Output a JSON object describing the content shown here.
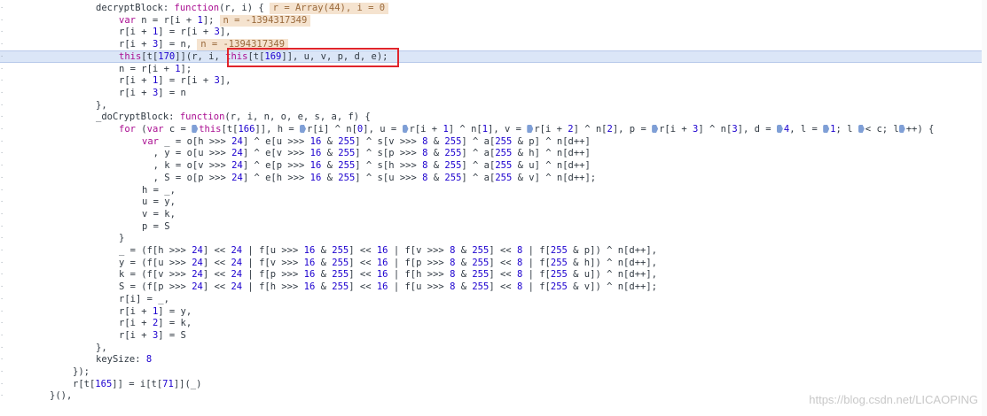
{
  "lines": [
    {
      "indent": 108,
      "text": "decryptBlock: function(r, i) {",
      "annotation": "r = Array(44), i = 0"
    },
    {
      "indent": 134,
      "text": "var n = r[i + 1];",
      "annotation": "n = -1394317349"
    },
    {
      "indent": 134,
      "text": "r[i + 1] = r[i + 3],",
      "annotation": ""
    },
    {
      "indent": 134,
      "text": "r[i + 3] = n,",
      "annotation": "n = -1394317349"
    },
    {
      "indent": 134,
      "text": "this[t[170]](r, i, this[t[169]], u, v, p, d, e);",
      "annotation": "",
      "highlight": true
    },
    {
      "indent": 134,
      "text": "n = r[i + 1];",
      "annotation": ""
    },
    {
      "indent": 134,
      "text": "r[i + 1] = r[i + 3],",
      "annotation": ""
    },
    {
      "indent": 134,
      "text": "r[i + 3] = n",
      "annotation": ""
    },
    {
      "indent": 108,
      "text": "},",
      "annotation": ""
    },
    {
      "indent": 108,
      "text": "_doCryptBlock: function(r, i, n, o, e, s, a, f) {",
      "annotation": ""
    },
    {
      "indent": 134,
      "text": "for (var c = ▸this[t[166]], h = ▸r[i] ^ n[0], u = ▸r[i + 1] ^ n[1], v = ▸r[i + 2] ^ n[2], p = ▸r[i + 3] ^ n[3], d = ▸4, l = ▸1; l ▸< c; l▸++) {",
      "annotation": ""
    },
    {
      "indent": 160,
      "text": "var _ = o[h >>> 24] ^ e[u >>> 16 & 255] ^ s[v >>> 8 & 255] ^ a[255 & p] ^ n[d++]",
      "annotation": ""
    },
    {
      "indent": 160,
      "text": "  , y = o[u >>> 24] ^ e[v >>> 16 & 255] ^ s[p >>> 8 & 255] ^ a[255 & h] ^ n[d++]",
      "annotation": ""
    },
    {
      "indent": 160,
      "text": "  , k = o[v >>> 24] ^ e[p >>> 16 & 255] ^ s[h >>> 8 & 255] ^ a[255 & u] ^ n[d++]",
      "annotation": ""
    },
    {
      "indent": 160,
      "text": "  , S = o[p >>> 24] ^ e[h >>> 16 & 255] ^ s[u >>> 8 & 255] ^ a[255 & v] ^ n[d++];",
      "annotation": ""
    },
    {
      "indent": 160,
      "text": "h = _,",
      "annotation": ""
    },
    {
      "indent": 160,
      "text": "u = y,",
      "annotation": ""
    },
    {
      "indent": 160,
      "text": "v = k,",
      "annotation": ""
    },
    {
      "indent": 160,
      "text": "p = S",
      "annotation": ""
    },
    {
      "indent": 134,
      "text": "}",
      "annotation": ""
    },
    {
      "indent": 134,
      "text": "_ = (f[h >>> 24] << 24 | f[u >>> 16 & 255] << 16 | f[v >>> 8 & 255] << 8 | f[255 & p]) ^ n[d++],",
      "annotation": ""
    },
    {
      "indent": 134,
      "text": "y = (f[u >>> 24] << 24 | f[v >>> 16 & 255] << 16 | f[p >>> 8 & 255] << 8 | f[255 & h]) ^ n[d++],",
      "annotation": ""
    },
    {
      "indent": 134,
      "text": "k = (f[v >>> 24] << 24 | f[p >>> 16 & 255] << 16 | f[h >>> 8 & 255] << 8 | f[255 & u]) ^ n[d++],",
      "annotation": ""
    },
    {
      "indent": 134,
      "text": "S = (f[p >>> 24] << 24 | f[h >>> 16 & 255] << 16 | f[u >>> 8 & 255] << 8 | f[255 & v]) ^ n[d++];",
      "annotation": ""
    },
    {
      "indent": 134,
      "text": "r[i] = _,",
      "annotation": ""
    },
    {
      "indent": 134,
      "text": "r[i + 1] = y,",
      "annotation": ""
    },
    {
      "indent": 134,
      "text": "r[i + 2] = k,",
      "annotation": ""
    },
    {
      "indent": 134,
      "text": "r[i + 3] = S",
      "annotation": ""
    },
    {
      "indent": 108,
      "text": "},",
      "annotation": ""
    },
    {
      "indent": 108,
      "text": "keySize: 8",
      "annotation": ""
    },
    {
      "indent": 82,
      "text": "});",
      "annotation": ""
    },
    {
      "indent": 82,
      "text": "r[t[165]] = i[t[71]](_)",
      "annotation": ""
    },
    {
      "indent": 56,
      "text": "}(),",
      "annotation": ""
    }
  ],
  "watermark": "https://blog.csdn.net/LICAOPING",
  "colors": {
    "highlight_bg": "#dbe6f7",
    "annotation_bg": "#f5e3cf",
    "red_box": "#e0252c",
    "marker": "#7f9fd6"
  }
}
